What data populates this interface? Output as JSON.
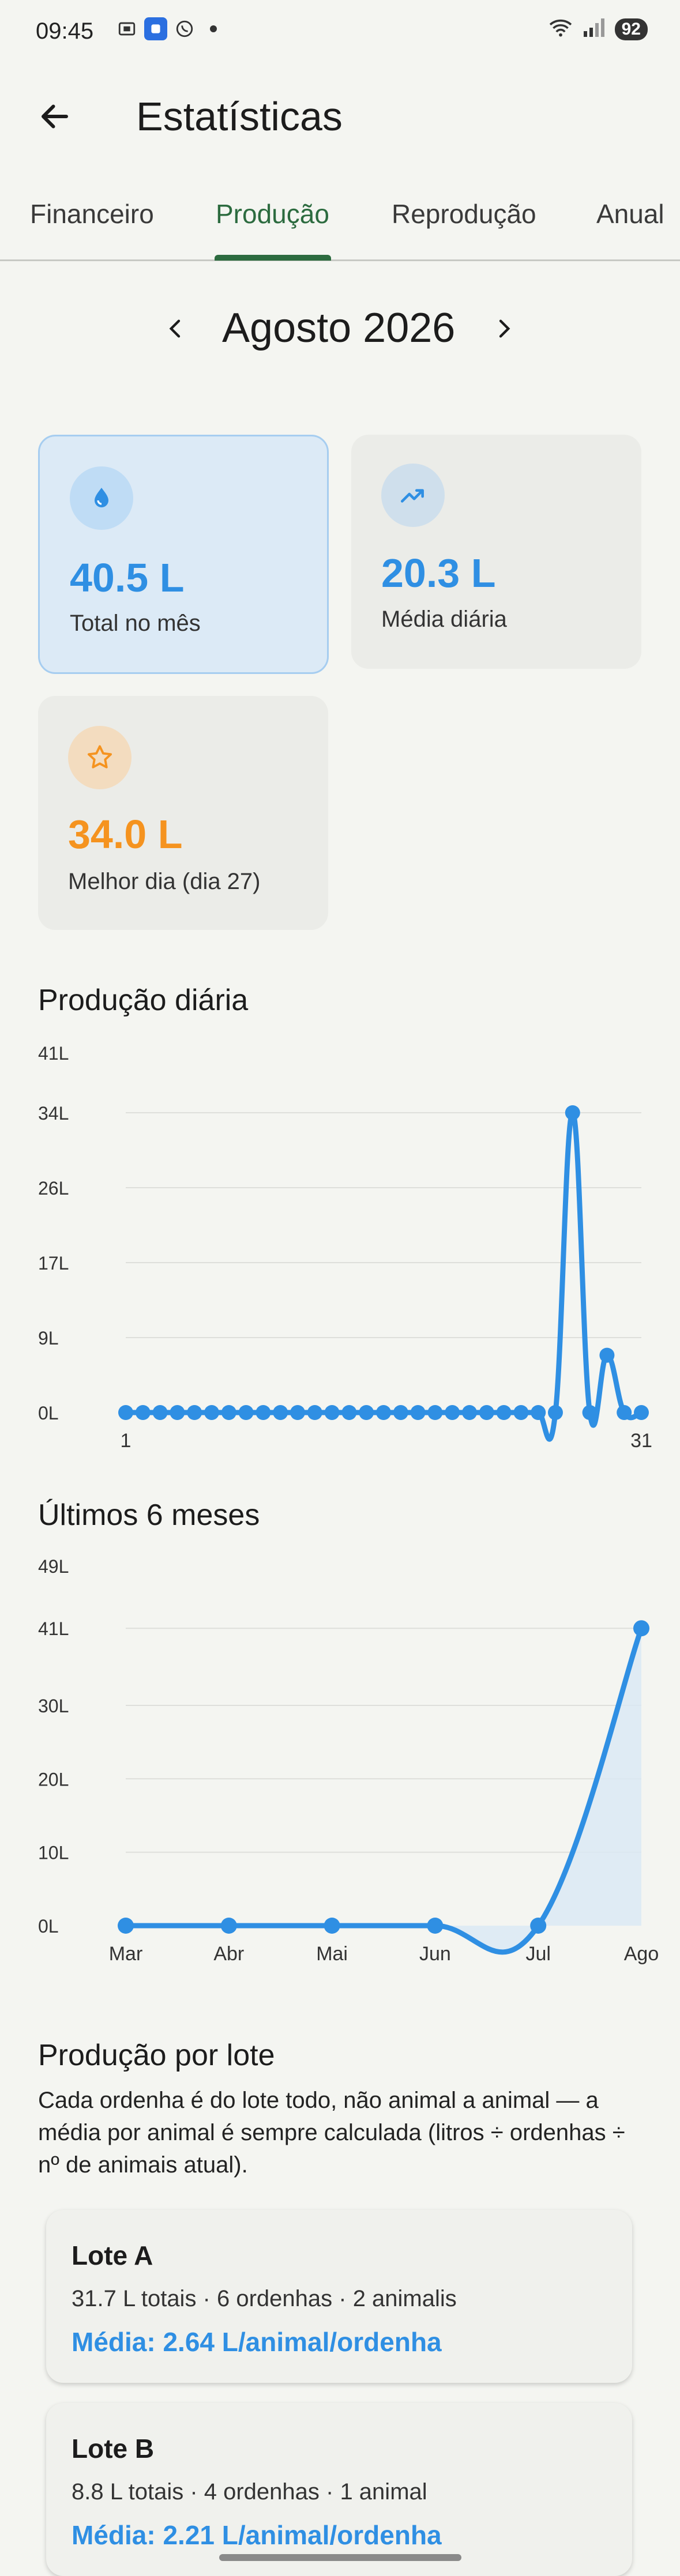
{
  "status_bar": {
    "time": "09:45",
    "battery": "92"
  },
  "header": {
    "title": "Estatísticas"
  },
  "tabs": [
    {
      "label": "Financeiro"
    },
    {
      "label": "Produção",
      "active": true
    },
    {
      "label": "Reprodução"
    },
    {
      "label": "Anual"
    }
  ],
  "month": {
    "label": "Agosto 2026"
  },
  "stats": {
    "total": {
      "value": "40.5 L",
      "label": "Total no mês",
      "color": "#2f8fe3"
    },
    "avg": {
      "value": "20.3 L",
      "label": "Média diária",
      "color": "#2f8fe3"
    },
    "best": {
      "value": "34.0 L",
      "label": "Melhor dia (dia 27)",
      "color": "#f5931f"
    }
  },
  "daily": {
    "title": "Produção diária"
  },
  "monthly": {
    "title": "Últimos 6 meses"
  },
  "lotes_section": {
    "title": "Produção por lote",
    "description": "Cada ordenha é do lote todo, não animal a animal — a média por animal é sempre calculada (litros ÷ ordenhas ÷ nº de animais atual).",
    "lotes": [
      {
        "name": "Lote A",
        "info": "31.7 L totais · 6 ordenhas · 2 animalis",
        "avg": "Média: 2.64 L/animal/ordenha"
      },
      {
        "name": "Lote B",
        "info": "8.8 L totais · 4 ordenhas · 1 animal",
        "avg": "Média: 2.21 L/animal/ordenha"
      }
    ]
  },
  "chart_data": [
    {
      "type": "line",
      "title": "Produção diária",
      "y_ticks": [
        "0L",
        "9L",
        "17L",
        "26L",
        "34L",
        "41L"
      ],
      "y_tick_values": [
        0,
        8.5,
        17,
        25.5,
        34,
        40.8
      ],
      "ylim": [
        0,
        40.8
      ],
      "x_tick_labels": [
        "1",
        "31"
      ],
      "x": [
        1,
        2,
        3,
        4,
        5,
        6,
        7,
        8,
        9,
        10,
        11,
        12,
        13,
        14,
        15,
        16,
        17,
        18,
        19,
        20,
        21,
        22,
        23,
        24,
        25,
        26,
        27,
        28,
        29,
        30,
        31
      ],
      "values": [
        0,
        0,
        0,
        0,
        0,
        0,
        0,
        0,
        0,
        0,
        0,
        0,
        0,
        0,
        0,
        0,
        0,
        0,
        0,
        0,
        0,
        0,
        0,
        0,
        0,
        0,
        34,
        0,
        6.5,
        0,
        0
      ],
      "color": "#2f8fe3",
      "grid": true
    },
    {
      "type": "area",
      "title": "Últimos 6 meses",
      "y_ticks": [
        "0L",
        "10L",
        "20L",
        "30L",
        "41L",
        "49L"
      ],
      "y_tick_values": [
        0,
        10,
        20,
        30,
        40.5,
        49
      ],
      "ylim": [
        0,
        49
      ],
      "categories": [
        "Mar",
        "Abr",
        "Mai",
        "Jun",
        "Jul",
        "Ago"
      ],
      "values": [
        0,
        0,
        0,
        0,
        0,
        40.5
      ],
      "color": "#2f8fe3",
      "grid": true
    }
  ]
}
